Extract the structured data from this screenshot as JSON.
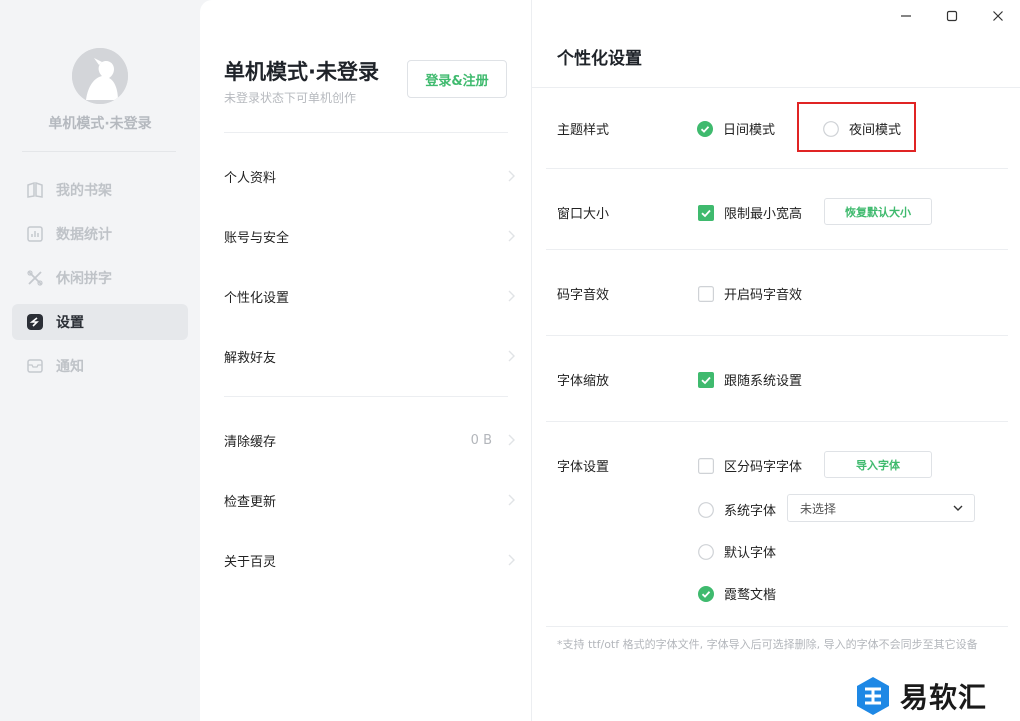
{
  "sidebar": {
    "username": "单机模式·未登录",
    "items": [
      {
        "label": "我的书架",
        "icon": "book-icon"
      },
      {
        "label": "数据统计",
        "icon": "chart-icon"
      },
      {
        "label": "休闲拼字",
        "icon": "puzzle-icon"
      },
      {
        "label": "设置",
        "icon": "settings-icon",
        "active": true
      },
      {
        "label": "通知",
        "icon": "mail-icon"
      }
    ]
  },
  "profile": {
    "title": "单机模式·未登录",
    "subtitle": "未登录状态下可单机创作",
    "login_label": "登录&注册"
  },
  "menu": [
    {
      "label": "个人资料"
    },
    {
      "label": "账号与安全"
    },
    {
      "label": "个性化设置"
    },
    {
      "label": "解救好友"
    },
    {
      "label": "清除缓存",
      "value": "0 B"
    },
    {
      "label": "检查更新"
    },
    {
      "label": "关于百灵"
    }
  ],
  "settings": {
    "title": "个性化设置",
    "theme": {
      "label": "主题样式",
      "day": "日间模式",
      "night": "夜间模式",
      "selected": "day"
    },
    "window": {
      "label": "窗口大小",
      "limit_label": "限制最小宽高",
      "limit_checked": true,
      "restore_label": "恢复默认大小"
    },
    "sound": {
      "label": "码字音效",
      "enable_label": "开启码字音效",
      "checked": false
    },
    "scale": {
      "label": "字体缩放",
      "follow_label": "跟随系统设置",
      "checked": true
    },
    "font": {
      "label": "字体设置",
      "distinguish_label": "区分码字字体",
      "distinguish_checked": false,
      "import_label": "导入字体",
      "system_label": "系统字体",
      "system_select_value": "未选择",
      "default_label": "默认字体",
      "lxgw_label": "霞鹜文楷",
      "selected": "lxgw"
    },
    "footnote": "*支持 ttf/otf 格式的字体文件, 字体导入后可选择删除, 导入的字体不会同步至其它设备"
  },
  "watermark": {
    "text": "易软汇"
  },
  "colors": {
    "accent": "#3fba6e",
    "highlight": "#e02424",
    "sidebar_bg": "#f3f4f6"
  }
}
